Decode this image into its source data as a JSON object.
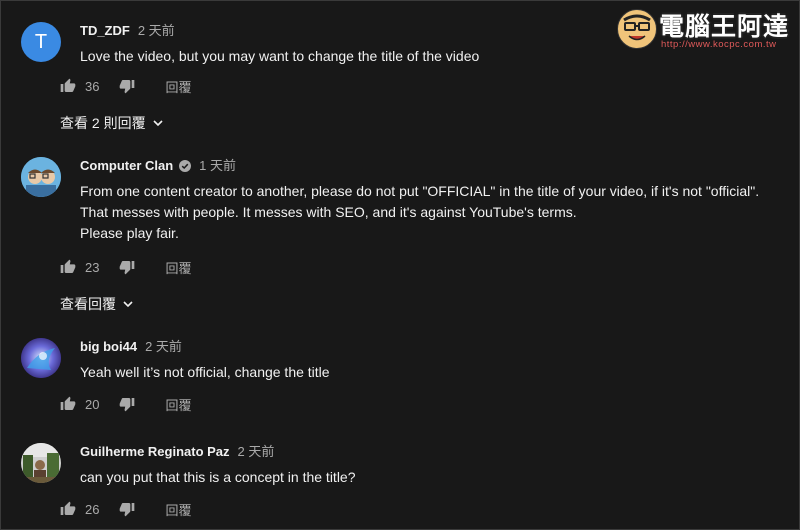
{
  "logo": {
    "title": "電腦王阿達",
    "url": "http://www.kocpc.com.tw"
  },
  "comments": [
    {
      "author": "TD_ZDF",
      "avatar_letter": "T",
      "avatar_color": "#3a8ae3",
      "time": "2 天前",
      "verified": false,
      "text": [
        "Love the video, but you may want to change the title of the video"
      ],
      "likes": "36",
      "reply_label": "回覆",
      "replies_toggle": "查看 2 則回覆"
    },
    {
      "author": "Computer Clan",
      "time": "1 天前",
      "verified": true,
      "text": [
        "From one content creator to another, please do not put \"OFFICIAL\" in the title of your video, if it's not \"official\".",
        "That messes with people. It messes with SEO, and it's against YouTube's terms.",
        "Please play fair."
      ],
      "likes": "23",
      "reply_label": "回覆",
      "replies_toggle": "查看回覆"
    },
    {
      "author": "big boi44",
      "time": "2 天前",
      "verified": false,
      "text": [
        "Yeah well it’s not official, change the title"
      ],
      "likes": "20",
      "reply_label": "回覆"
    },
    {
      "author": "Guilherme Reginato Paz",
      "time": "2 天前",
      "verified": false,
      "text": [
        "can you put that this is a concept in the title?"
      ],
      "likes": "26",
      "reply_label": "回覆"
    }
  ]
}
